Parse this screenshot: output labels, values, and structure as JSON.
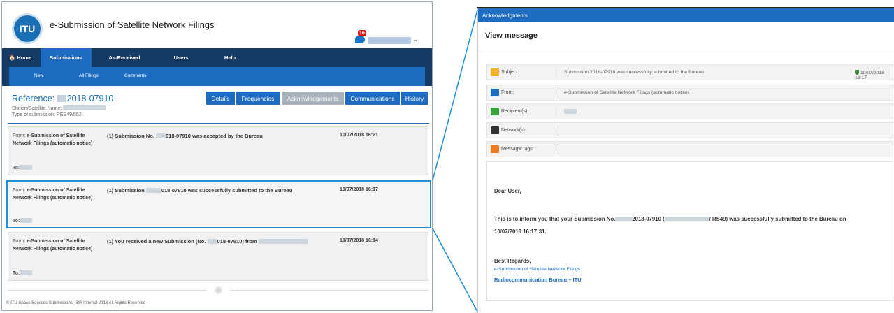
{
  "app": {
    "logo_text": "ITU",
    "title": "e-Submission of Satellite Network Filings",
    "notification_count": "16"
  },
  "nav": {
    "items": [
      {
        "label": "🏠 Home"
      },
      {
        "label": "Submissions"
      },
      {
        "label": "As-Received"
      },
      {
        "label": "Users"
      },
      {
        "label": "Help"
      }
    ],
    "active": "Submissions",
    "sub_items": [
      {
        "label": "New"
      },
      {
        "label": "All Filings"
      },
      {
        "label": "Comments"
      }
    ]
  },
  "reference": {
    "label": "Reference: ",
    "value": "2018-07910",
    "station_label": "Station/Satellite Name: ",
    "type_label": "Type of submission: ",
    "type_value": "RES49/552"
  },
  "tabs": [
    {
      "label": "Details"
    },
    {
      "label": "Frequencies"
    },
    {
      "label": "Acknowledgements"
    },
    {
      "label": "Communications"
    },
    {
      "label": "History"
    }
  ],
  "messages": [
    {
      "from_prefix": "From: ",
      "from": "e-Submission of Satellite Network Filings (automatic notice)",
      "subject_a": "(1) Submission No. ",
      "subject_b": "018-07910 was accepted by the Bureau",
      "date": "10/07/2018 16:21",
      "to_label": "To:"
    },
    {
      "from_prefix": "From: ",
      "from": "e-Submission of Satellite Network Filings (automatic notice)",
      "subject_a": "(1) Submission ",
      "subject_b": "018-07910 was successfully submitted to the Bureau",
      "date": "10/07/2018 16:17",
      "to_label": "To:"
    },
    {
      "from_prefix": "From: ",
      "from": "e-Submission of Satellite Network Filings (automatic notice)",
      "subject_a": "(1) You received a new Submission (No. ",
      "subject_b": "018-07910) from",
      "date": "10/07/2018 16:14",
      "to_label": "To:"
    }
  ],
  "footer": "© ITU Space Services Submissions - BR Internal 2018 All Rights Reserved",
  "detail": {
    "header": "Acknowledgments",
    "title": "View message",
    "fields": [
      {
        "label": "Subject:",
        "value": "Submission 2018-07910 was successfully submitted to the Bureau",
        "date": "10/07/2018 16:17"
      },
      {
        "label": "From:",
        "value": "e-Submission of Satellite Network Filings (automatic notice)"
      },
      {
        "label": "Recipient(s):",
        "value": ""
      },
      {
        "label": "Network(s):",
        "value": ""
      },
      {
        "label": "Messagw tags:",
        "value": ""
      }
    ],
    "greeting": "Dear User,",
    "body_a": "This is to inform you that your Submission No.",
    "body_b": "2018-07910 (",
    "body_c": "/ RS49) was successfully submitted to the Bureau on",
    "body_d": "10/07/2018 16:17:31.",
    "regards": "Best Regards,",
    "sig_line1": "e-Submission of Satellite Network Filings",
    "sig_line2": "Radiocommunication Bureau – ITU"
  },
  "colors": {
    "nav_dark": "#143a66",
    "accent": "#1e6cc2",
    "highlight": "#1f8fd6"
  }
}
